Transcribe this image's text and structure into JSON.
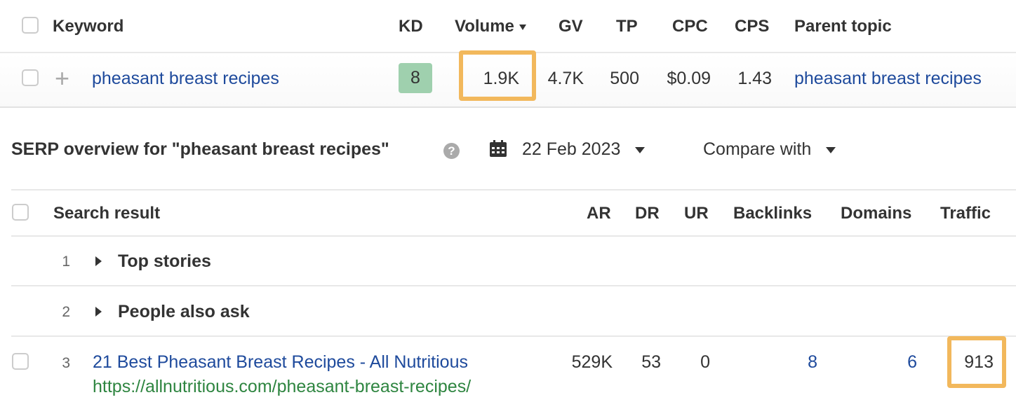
{
  "keywords_table": {
    "headers": {
      "keyword": "Keyword",
      "kd": "KD",
      "volume": "Volume",
      "gv": "GV",
      "tp": "TP",
      "cpc": "CPC",
      "cps": "CPS",
      "parent_topic": "Parent topic"
    },
    "row": {
      "keyword": "pheasant breast recipes",
      "kd": "8",
      "volume": "1.9K",
      "gv": "4.7K",
      "tp": "500",
      "cpc": "$0.09",
      "cps": "1.43",
      "parent_topic": "pheasant breast recipes"
    },
    "kd_color": "#9fd0ae",
    "highlight_color": "#f2b85c"
  },
  "serp": {
    "title": "SERP overview for \"pheasant breast recipes\"",
    "date": "22 Feb 2023",
    "compare_label": "Compare with",
    "headers": {
      "result": "Search result",
      "ar": "AR",
      "dr": "DR",
      "ur": "UR",
      "backlinks": "Backlinks",
      "domains": "Domains",
      "traffic": "Traffic"
    },
    "rows": [
      {
        "pos": "1",
        "title": "Top stories"
      },
      {
        "pos": "2",
        "title": "People also ask"
      },
      {
        "pos": "3",
        "title": "21 Best Pheasant Breast Recipes - All Nutritious",
        "url": "https://allnutritious.com/pheasant-breast-recipes/",
        "ar": "529K",
        "dr": "53",
        "ur": "0",
        "backlinks": "8",
        "domains": "6",
        "traffic": "913"
      }
    ]
  }
}
